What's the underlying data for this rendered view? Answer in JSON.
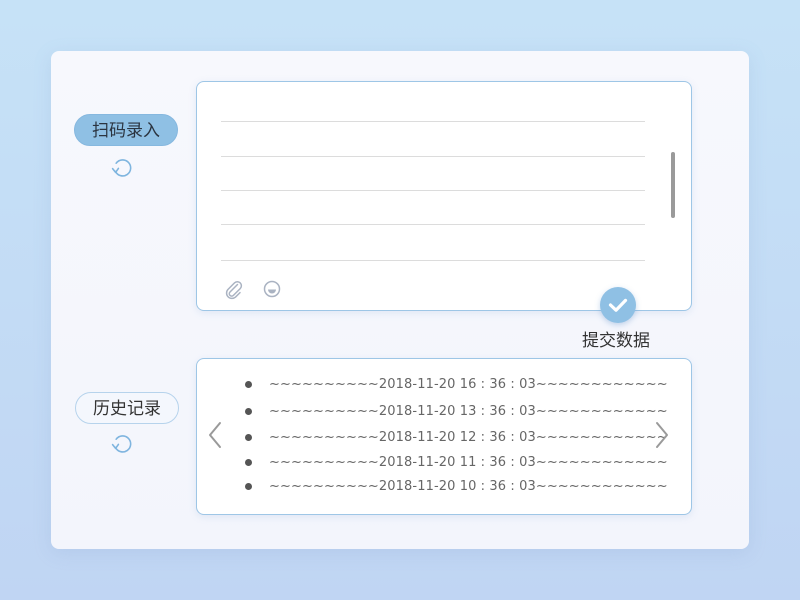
{
  "scan_section": {
    "label": "扫码录入",
    "refresh_icon": "refresh-icon"
  },
  "input_panel": {
    "line_count": 5,
    "tools": [
      "paperclip-icon",
      "emoji-icon"
    ]
  },
  "submit": {
    "icon": "check-icon",
    "label": "提交数据"
  },
  "history_section": {
    "label": "历史记录",
    "refresh_icon": "refresh-icon"
  },
  "history": {
    "records": [
      "~~~~~~~~~~2018-11-20   16 : 36 : 03~~~~~~~~~~~~",
      "~~~~~~~~~~2018-11-20   13 : 36 : 03~~~~~~~~~~~~",
      "~~~~~~~~~~2018-11-20   12 : 36 : 03~~~~~~~~~~~~",
      "~~~~~~~~~~2018-11-20   11 : 36 : 03~~~~~~~~~~~~",
      "~~~~~~~~~~2018-11-20   10 : 36 : 03~~~~~~~~~~~~"
    ],
    "prev_icon": "chevron-left-icon",
    "next_icon": "chevron-right-icon"
  },
  "colors": {
    "accent": "#8fc0e4",
    "panel_border": "#9ec6e6",
    "background_top": "#c6e2f7",
    "background_bottom": "#c0d5f3"
  }
}
